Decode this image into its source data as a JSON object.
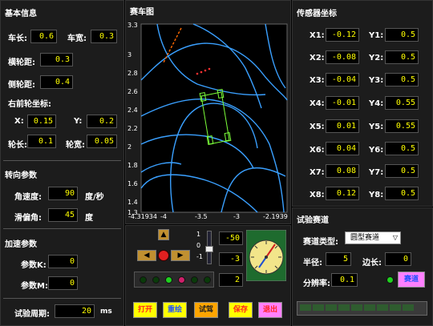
{
  "basic": {
    "title": "基本信息",
    "car_len_label": "车长:",
    "car_len": "0.6",
    "car_wid_label": "车宽:",
    "car_wid": "0.3",
    "wheelbase_label": "横轮距:",
    "wheelbase": "0.3",
    "side_label": "侧轮距:",
    "side": "0.4",
    "coord_title": "右前轮坐标:",
    "x_label": "X:",
    "x": "0.15",
    "y_label": "Y:",
    "y": "0.2",
    "wheel_len_label": "轮长:",
    "wheel_len": "0.1",
    "wheel_wid_label": "轮宽:",
    "wheel_wid": "0.05"
  },
  "steer": {
    "title": "转向参数",
    "ang_vel_label": "角速度:",
    "ang_vel": "90",
    "ang_vel_unit": "度/秒",
    "slip_label": "滑偏角:",
    "slip": "45",
    "slip_unit": "度"
  },
  "accel": {
    "title": "加速参数",
    "k_label": "参数K:",
    "k": "0",
    "m_label": "参数M:",
    "m": "0"
  },
  "period": {
    "label": "试验周期:",
    "value": "20",
    "unit": "ms"
  },
  "track": {
    "title": "赛车图",
    "y_ticks": [
      "3.3",
      "3",
      "2.8",
      "2.6",
      "2.4",
      "2.2",
      "2",
      "1.8",
      "1.6",
      "1.4",
      "1.3"
    ],
    "x_ticks": [
      "-4.31934",
      "-4",
      "-3.5",
      "-3",
      "-2.1939"
    ]
  },
  "controls": {
    "slider_ticks": [
      "1",
      "0",
      "-1"
    ],
    "val1": "-50",
    "val2": "-3",
    "val3": "2"
  },
  "buttons": {
    "open": "打开",
    "redraw": "重绘",
    "test": "试驾",
    "save": "保存",
    "exit": "退出"
  },
  "sensor": {
    "title": "传感器坐标",
    "rows": [
      {
        "xl": "X1:",
        "x": "-0.12",
        "yl": "Y1:",
        "y": "0.5"
      },
      {
        "xl": "X2:",
        "x": "-0.08",
        "yl": "Y2:",
        "y": "0.5"
      },
      {
        "xl": "X3:",
        "x": "-0.04",
        "yl": "Y3:",
        "y": "0.5"
      },
      {
        "xl": "X4:",
        "x": "-0.01",
        "yl": "Y4:",
        "y": "0.55"
      },
      {
        "xl": "X5:",
        "x": "0.01",
        "yl": "Y5:",
        "y": "0.55"
      },
      {
        "xl": "X6:",
        "x": "0.04",
        "yl": "Y6:",
        "y": "0.5"
      },
      {
        "xl": "X7:",
        "x": "0.08",
        "yl": "Y7:",
        "y": "0.5"
      },
      {
        "xl": "X8:",
        "x": "0.12",
        "yl": "Y8:",
        "y": "0.5"
      }
    ]
  },
  "testtrack": {
    "title": "试验赛道",
    "type_label": "赛道类型:",
    "type_value": "圆型赛道",
    "radius_label": "半径:",
    "radius": "5",
    "edge_label": "边长:",
    "edge": "0",
    "res_label": "分辨率:",
    "res": "0.1",
    "track_btn": "赛道"
  }
}
